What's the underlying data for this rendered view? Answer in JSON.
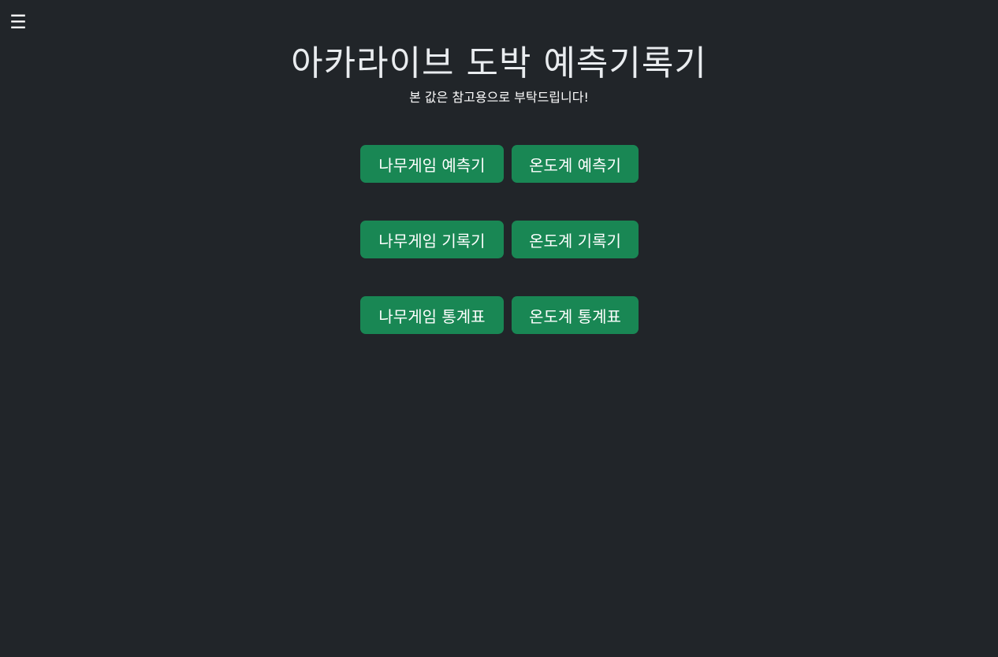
{
  "menu": {
    "icon": "hamburger-menu-icon",
    "glyph": "☰"
  },
  "header": {
    "title": "아카라이브 도박 예측기록기",
    "subtitle": "본 값은 참고용으로 부탁드립니다!"
  },
  "buttons": [
    {
      "left": "나무게임 예측기",
      "right": "온도계 예측기"
    },
    {
      "left": "나무게임 기록기",
      "right": "온도계 기록기"
    },
    {
      "left": "나무게임 통계표",
      "right": "온도계 통계표"
    }
  ],
  "colors": {
    "background": "#212529",
    "button": "#198754",
    "text": "#ffffff"
  }
}
